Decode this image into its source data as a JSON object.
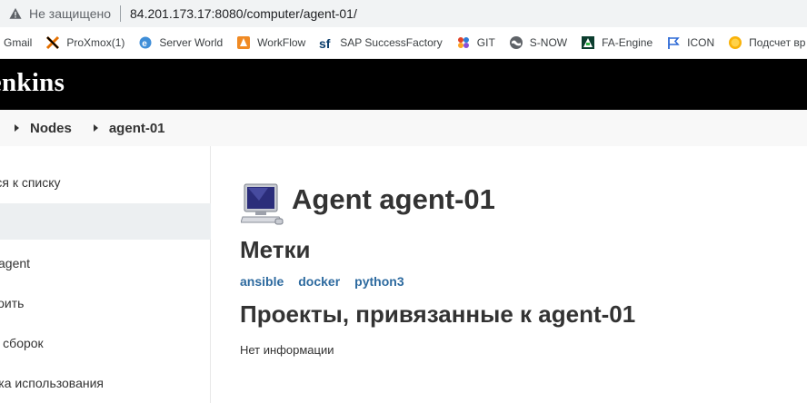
{
  "browser": {
    "security_label": "Не защищено",
    "url": "84.201.173.17:8080/computer/agent-01/"
  },
  "bookmarks": [
    {
      "label": "Gmail",
      "icon": "gmail-icon"
    },
    {
      "label": "ProXmox(1)",
      "icon": "proxmox-icon"
    },
    {
      "label": "Server World",
      "icon": "ie-icon"
    },
    {
      "label": "WorkFlow",
      "icon": "workflow-icon"
    },
    {
      "label": "SAP SuccessFactory",
      "icon": "sf-icon"
    },
    {
      "label": "GIT",
      "icon": "git-icon"
    },
    {
      "label": "S-NOW",
      "icon": "globe-icon"
    },
    {
      "label": "FA-Engine",
      "icon": "fa-engine-icon"
    },
    {
      "label": "ICON",
      "icon": "flag-icon"
    },
    {
      "label": "Подсчет вр",
      "icon": "circle-icon"
    }
  ],
  "header": {
    "logo_text": "Jenkins"
  },
  "breadcrumb": {
    "items": [
      "Nodes",
      "agent-01"
    ]
  },
  "sidebar": {
    "items": [
      {
        "label": "Вернуться к списку"
      },
      {
        "label": ""
      },
      {
        "label": "Build agent"
      },
      {
        "label": "Настроить"
      },
      {
        "label": "История сборок"
      },
      {
        "label": "Статистика использования"
      }
    ]
  },
  "main": {
    "title": "Agent agent-01",
    "labels_heading": "Метки",
    "labels": [
      "ansible",
      "docker",
      "python3"
    ],
    "projects_heading": "Проекты, привязанные к agent-01",
    "no_info": "Нет информации"
  },
  "colors": {
    "header_bg": "#000000",
    "link": "#2d6a9f",
    "active_item": "#eceff1"
  }
}
